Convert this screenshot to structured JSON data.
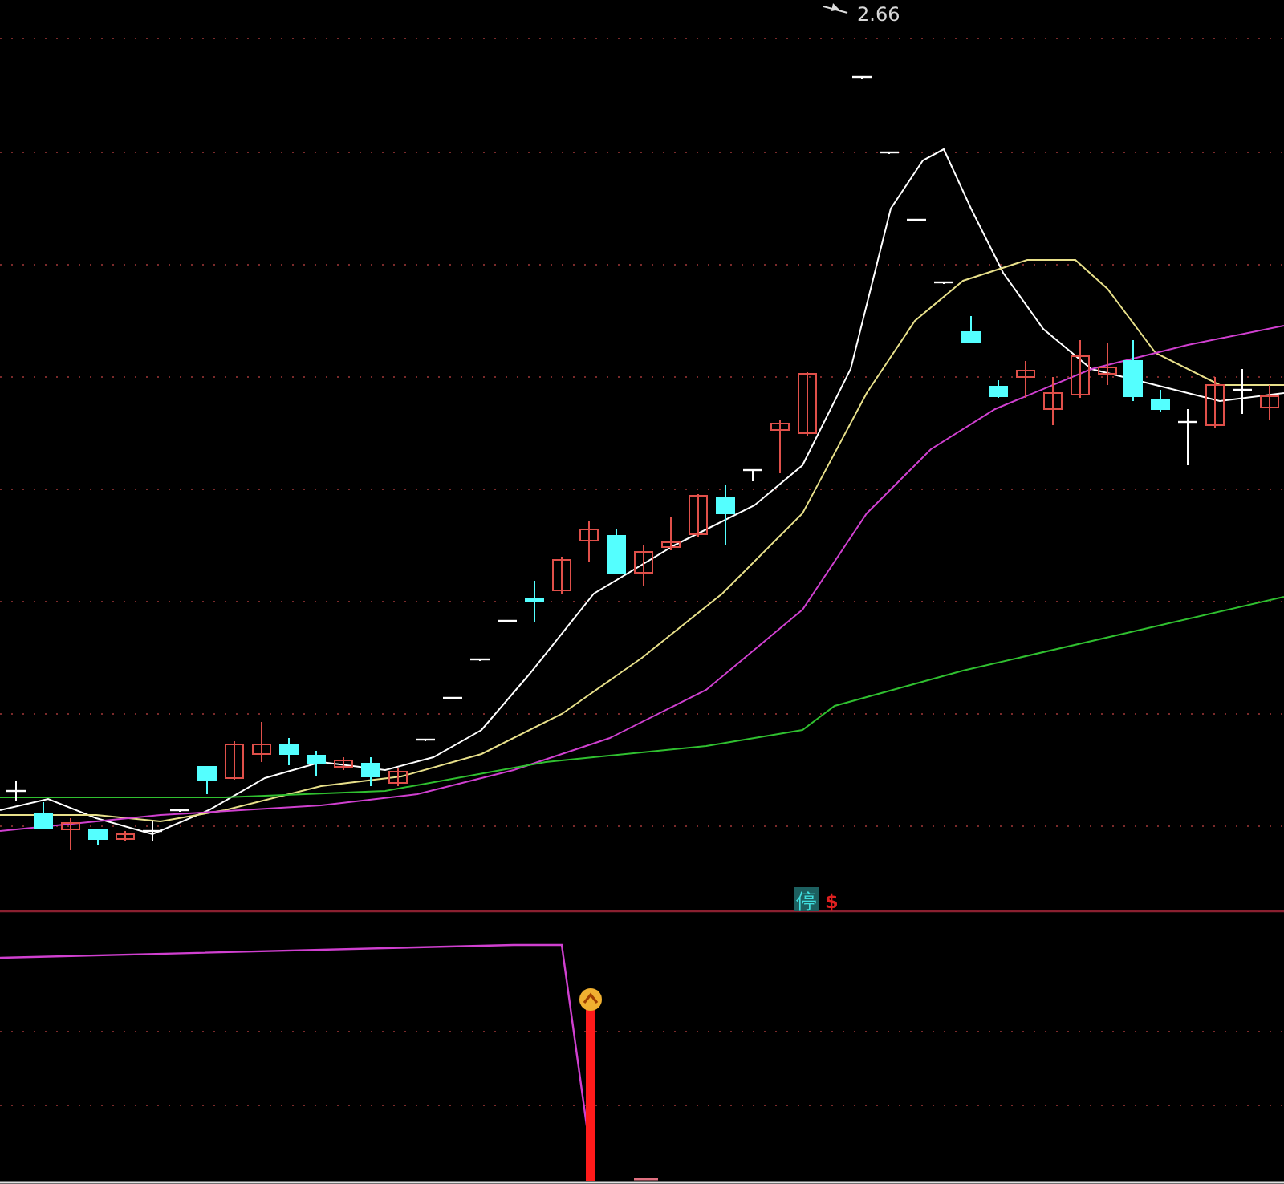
{
  "price_label": "2.66",
  "signal_badge": "停",
  "signal_mark": "$"
}
